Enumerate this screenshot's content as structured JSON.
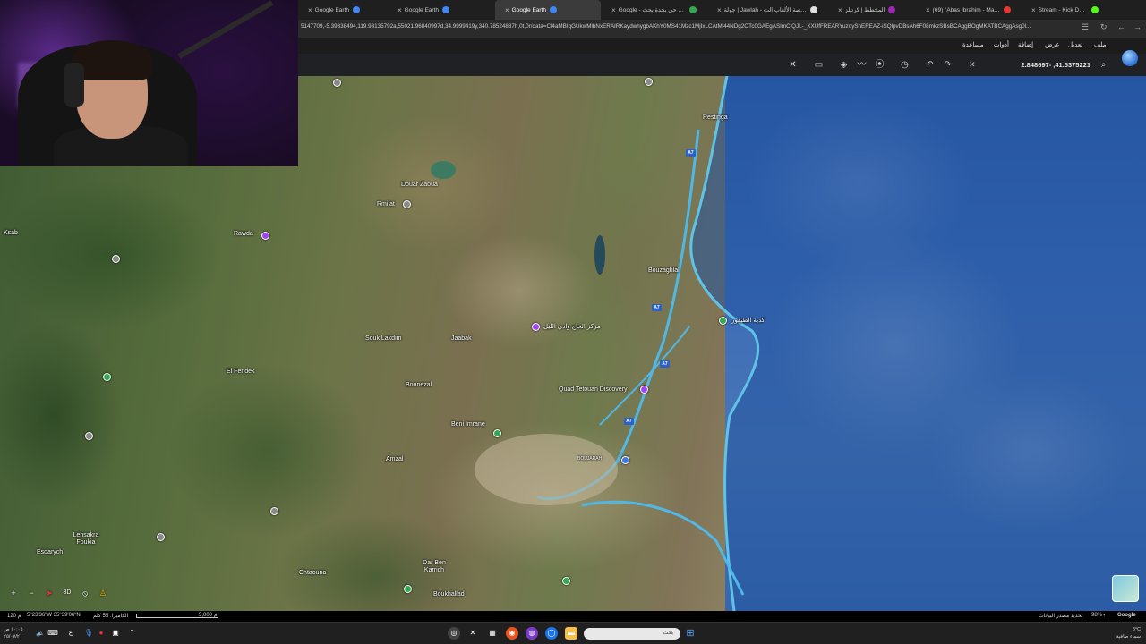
{
  "browser": {
    "tabs": [
      {
        "title": "Google Earth",
        "active": false,
        "color": "#4285f4"
      },
      {
        "title": "Google Earth",
        "active": false,
        "color": "#4285f4"
      },
      {
        "title": "Google Earth",
        "active": true,
        "color": "#4285f4"
      },
      {
        "title": "Google - أفضل حي بجدة بحث",
        "active": false,
        "color": "#34a853"
      },
      {
        "title": "جولة | Jawlah - منصة الألعاب الت...",
        "active": false,
        "color": "#e0e0e0"
      },
      {
        "title": "المخطط | كرتيلز",
        "active": false,
        "color": "#9c27b0"
      },
      {
        "title": "(69) \"Abas Ibrahim - Manta...",
        "active": false,
        "color": "#e53935"
      },
      {
        "title": "Stream - Kick Dashboard",
        "active": false,
        "color": "#53fc18"
      }
    ],
    "address": "5147709,-5.39338494,119.93135792a,55021.96840997d,34.9999419y,340.78524837h,0t,0r/data=Cl4aMBIqGUkwMlbNxERAIRKaydwhygbAKhY0MS41Mzc1MjIxLCAtMi44NDg2OTc0GAEgASImCiQJL-_XXUfFREARYuzoySnEREAZ-iSQlpvDBsAh6F08mkzSBsBCAggBOgMKATBCAggAsg0l..."
  },
  "earth_menu": {
    "file": "ملف",
    "edit": "تعديل",
    "view": "عرض",
    "add": "إضافة",
    "tools": "أدوات",
    "help": "مساعدة"
  },
  "search": {
    "value": "2.848697- ,41.5375221"
  },
  "map": {
    "places": [
      {
        "name": "Restinga"
      },
      {
        "name": "Douar Zaoua"
      },
      {
        "name": "Rmilat"
      },
      {
        "name": "Rawda"
      },
      {
        "name": "Ksab"
      },
      {
        "name": "Bouzaghlal"
      },
      {
        "name": "Souk Lakdim"
      },
      {
        "name": "Jaabak"
      },
      {
        "name": "El Fendek"
      },
      {
        "name": "Bounezal"
      },
      {
        "name": "Quad Tetouan Discovery"
      },
      {
        "name": "Beni Imrane"
      },
      {
        "name": "Amzal"
      },
      {
        "name": "Lehsakra Foukia"
      },
      {
        "name": "Esqarych"
      },
      {
        "name": "Chtaouna"
      },
      {
        "name": "Dar Ben Karrich"
      },
      {
        "name": "Boukhallad"
      },
      {
        "name": "كدية الطيفور"
      },
      {
        "name": "مركز الحاج وادي الليل"
      },
      {
        "name": "BOUJARAH"
      }
    ],
    "roads": [
      "A7",
      "A7",
      "A7",
      "A7"
    ]
  },
  "status": {
    "coords": "5°23'36\"W 35°39'06\"N",
    "elevation": "120 م",
    "camera": "الكاميرا: 55 كلم",
    "scale": "5,000 م",
    "data_attribution": "تحديد مصدر البيانات",
    "zoom": "98%",
    "brand": "Google"
  },
  "taskbar": {
    "search_placeholder": "بحث",
    "time": "١٠:٠٥ ص",
    "date": "٢٥/٠٧/٢٠",
    "weather": "8°C",
    "weather_desc": "سماء صافية"
  }
}
